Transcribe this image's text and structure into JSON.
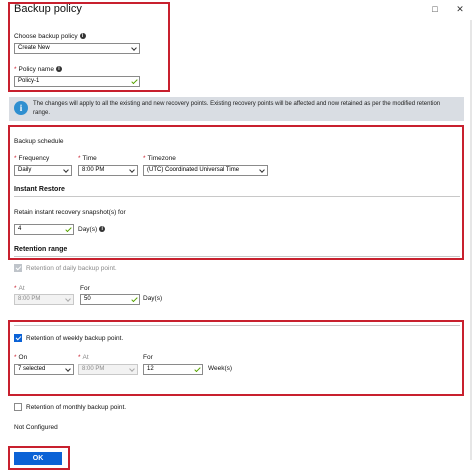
{
  "window": {
    "title": "Backup policy",
    "restore_icon": "□",
    "close_icon": "✕"
  },
  "choose_policy": {
    "label": "Choose backup policy",
    "value": "Create New"
  },
  "policy_name": {
    "label": "Policy name",
    "value": "Policy-1"
  },
  "info_banner": {
    "icon": "i",
    "text": "The changes will apply to all the existing and new recovery points. Existing recovery points will be affected and now retained as per the modified retention range."
  },
  "backup_schedule": {
    "heading": "Backup schedule",
    "frequency_label": "Frequency",
    "frequency_value": "Daily",
    "time_label": "Time",
    "time_value": "8:00 PM",
    "timezone_label": "Timezone",
    "timezone_value": "(UTC) Coordinated Universal Time"
  },
  "instant_restore": {
    "heading": "Instant Restore",
    "retain_label": "Retain instant recovery snapshot(s) for",
    "value": "4",
    "unit": "Day(s)"
  },
  "retention_range": {
    "heading": "Retention range"
  },
  "daily": {
    "checkbox_label": "Retention of daily backup point.",
    "at_label": "At",
    "at_value": "8:00 PM",
    "for_label": "For",
    "for_value": "50",
    "unit": "Day(s)"
  },
  "weekly": {
    "checkbox_label": "Retention of weekly backup point.",
    "on_label": "On",
    "on_value": "7 selected",
    "at_label": "At",
    "at_value": "8:00 PM",
    "for_label": "For",
    "for_value": "12",
    "unit": "Week(s)"
  },
  "monthly": {
    "checkbox_label": "Retention of monthly backup point.",
    "status": "Not Configured"
  },
  "ok_label": "OK",
  "colors": {
    "highlight": "#c8202e",
    "accent": "#0b62d6",
    "info": "#2f8fd0"
  }
}
